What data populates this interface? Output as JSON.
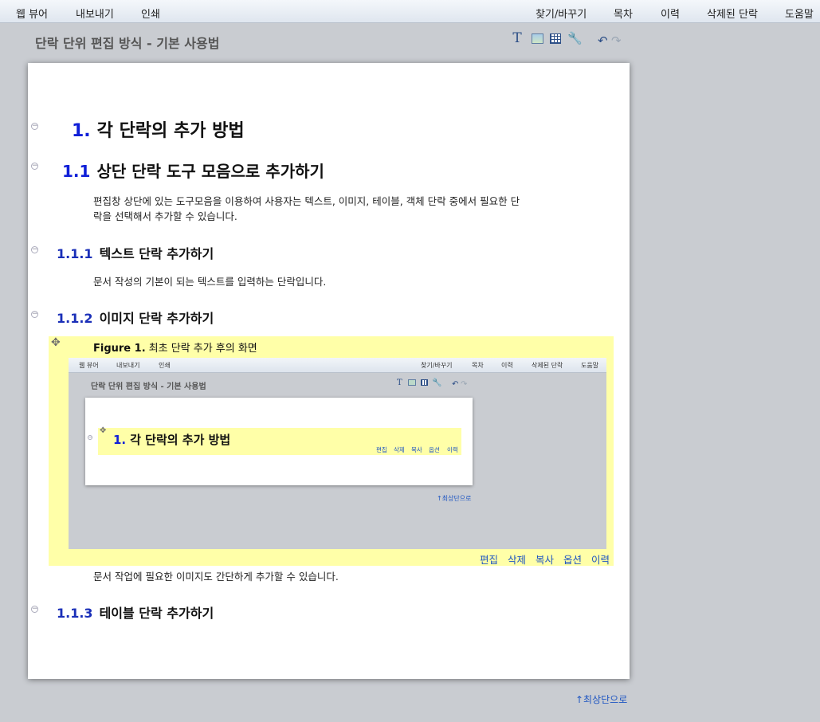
{
  "menu": {
    "left": [
      "웹 뷰어",
      "내보내기",
      "인쇄"
    ],
    "right": [
      "찾기/바꾸기",
      "목차",
      "이력",
      "삭제된 단락",
      "도움말"
    ]
  },
  "editor": {
    "title": "단락 단위 편집 방식 - 기본 사용법",
    "tools": {
      "text_glyph": "T",
      "object_glyph": "🔧",
      "undo_glyph": "↶",
      "redo_glyph": "↷"
    }
  },
  "document": {
    "h1": {
      "num": "1.",
      "text": "각 단락의 추가 방법"
    },
    "h2": {
      "num": "1.1",
      "text": "상단 단락 도구 모음으로 추가하기"
    },
    "p1_line1": "편집창 상단에 있는 도구모음을 이용하여 사용자는 텍스트, 이미지, 테이블, 객체 단락 중에서 필요한 단",
    "p1_line2": "락을 선택해서 추가할 수 있습니다.",
    "h3_1": {
      "num": "1.1.1",
      "text": "텍스트 단락 추가하기"
    },
    "p2": "문서 작성의 기본이 되는 텍스트를 입력하는 단락입니다.",
    "h3_2": {
      "num": "1.1.2",
      "text": "이미지 단락 추가하기"
    },
    "figure": {
      "label": "Figure 1.",
      "caption": "최초 단락 추가 후의 화면",
      "screenshot": {
        "menu_left": [
          "웹 뷰어",
          "내보내기",
          "인쇄"
        ],
        "menu_right": [
          "찾기/바꾸기",
          "목차",
          "이력",
          "삭제된 단락",
          "도움말"
        ],
        "title": "단락 단위 편집 방식 - 기본 사용법",
        "h1_num": "1.",
        "h1_text": "각 단락의 추가 방법",
        "actions": [
          "편집",
          "삭제",
          "복사",
          "옵션",
          "이력"
        ],
        "to_top": "↑최상단으로"
      }
    },
    "block_actions": [
      "편집",
      "삭제",
      "복사",
      "옵션",
      "이력"
    ],
    "p3": "문서 작업에 필요한 이미지도 간단하게 추가할 수 있습니다.",
    "h3_3": {
      "num": "1.1.3",
      "text": "테이블 단락 추가하기"
    }
  },
  "to_top": "↑최상단으로",
  "icons": {
    "collapse": "collapse-icon",
    "move": "move-icon",
    "text": "text-paragraph-icon",
    "image": "image-paragraph-icon",
    "table": "table-paragraph-icon",
    "object": "object-paragraph-icon",
    "undo": "undo-icon",
    "redo": "redo-icon"
  },
  "colors": {
    "selected_block": "#ffffa8",
    "heading_number": "#0f1fd8",
    "link": "#1f56c2",
    "background": "#c9ccd1"
  }
}
